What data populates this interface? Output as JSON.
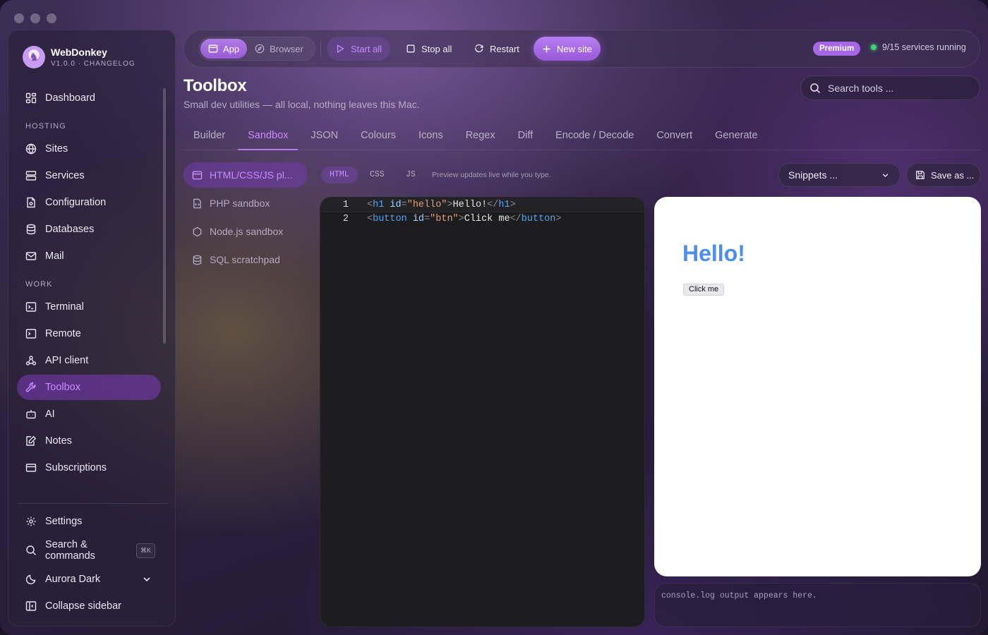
{
  "app": {
    "name": "WebDonkey",
    "version": "V1.0.0 · CHANGELOG"
  },
  "sidebar": {
    "dashboard": "Dashboard",
    "hosting_section": "HOSTING",
    "hosting": [
      {
        "label": "Sites",
        "icon": "globe-icon"
      },
      {
        "label": "Services",
        "icon": "server-icon"
      },
      {
        "label": "Configuration",
        "icon": "config-file-icon"
      },
      {
        "label": "Databases",
        "icon": "database-icon"
      },
      {
        "label": "Mail",
        "icon": "mail-icon"
      }
    ],
    "work_section": "WORK",
    "work": [
      {
        "label": "Terminal",
        "icon": "terminal-icon"
      },
      {
        "label": "Remote",
        "icon": "remote-terminal-icon"
      },
      {
        "label": "API client",
        "icon": "webhook-icon"
      },
      {
        "label": "Toolbox",
        "icon": "wrench-icon",
        "active": true
      },
      {
        "label": "AI",
        "icon": "bot-icon"
      },
      {
        "label": "Notes",
        "icon": "notes-icon"
      },
      {
        "label": "Subscriptions",
        "icon": "card-icon"
      }
    ],
    "settings": "Settings",
    "search_commands": "Search & commands",
    "search_shortcut": "⌘K",
    "theme": "Aurora Dark",
    "collapse": "Collapse sidebar"
  },
  "topbar": {
    "app_label": "App",
    "browser_label": "Browser",
    "start_all": "Start all",
    "stop_all": "Stop all",
    "restart": "Restart",
    "new_site": "New site",
    "premium": "Premium",
    "services_status": "9/15 services running",
    "status_color": "#3fd274"
  },
  "page": {
    "title": "Toolbox",
    "subtitle": "Small dev utilities — all local, nothing leaves this Mac.",
    "search_placeholder": "Search tools ..."
  },
  "tabs": [
    "Builder",
    "Sandbox",
    "JSON",
    "Colours",
    "Icons",
    "Regex",
    "Diff",
    "Encode / Decode",
    "Convert",
    "Generate"
  ],
  "active_tab": "Sandbox",
  "sandboxes": [
    {
      "label": "HTML/CSS/JS pl...",
      "icon": "browser-window-icon"
    },
    {
      "label": "PHP sandbox",
      "icon": "code-file-icon"
    },
    {
      "label": "Node.js sandbox",
      "icon": "hexagon-icon"
    },
    {
      "label": "SQL scratchpad",
      "icon": "database-icon"
    }
  ],
  "editor": {
    "langs": [
      "HTML",
      "CSS",
      "JS"
    ],
    "active_lang": "HTML",
    "hint": "Preview updates live while you type.",
    "snippets": "Snippets ...",
    "save_as": "Save as ...",
    "line_numbers": [
      "1",
      "2"
    ],
    "lines": [
      {
        "tag": "h1",
        "attr": "id",
        "val": "\"hello\"",
        "text": "Hello!"
      },
      {
        "tag": "button",
        "attr": "id",
        "val": "\"btn\"",
        "text": "Click me"
      }
    ]
  },
  "preview": {
    "heading": "Hello!",
    "button": "Click me",
    "heading_color": "#4a8ff0"
  },
  "console": {
    "placeholder": "console.log output appears here."
  },
  "colors": {
    "accent": "#b37bf0",
    "accent_text": "#c98bff"
  }
}
